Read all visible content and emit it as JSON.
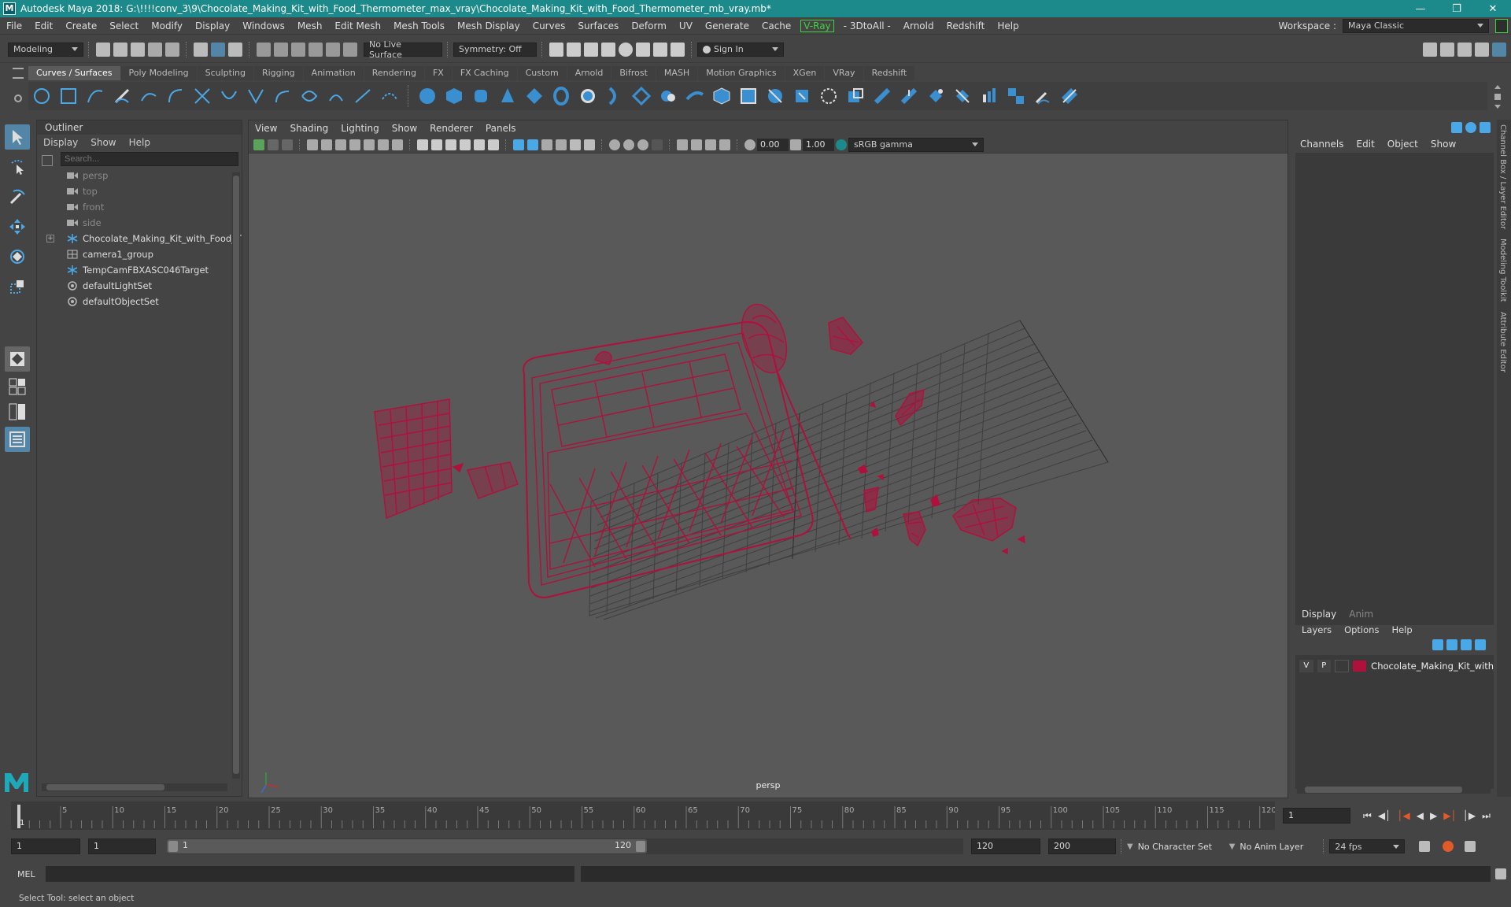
{
  "window": {
    "title": "Autodesk Maya 2018: G:\\!!!!conv_3\\9\\Chocolate_Making_Kit_with_Food_Thermometer_max_vray\\Chocolate_Making_Kit_with_Food_Thermometer_mb_vray.mb*",
    "logo": "M"
  },
  "menubar": {
    "items": [
      "File",
      "Edit",
      "Create",
      "Select",
      "Modify",
      "Display",
      "Windows",
      "Mesh",
      "Edit Mesh",
      "Mesh Tools",
      "Mesh Display",
      "Curves",
      "Surfaces",
      "Deform",
      "UV",
      "Generate",
      "Cache"
    ],
    "vray": "V-Ray",
    "items2": [
      "- 3DtoAll -",
      "Arnold",
      "Redshift",
      "Help"
    ],
    "workspace_label": "Workspace :",
    "workspace_value": "Maya Classic"
  },
  "statusline": {
    "mode": "Modeling",
    "live_surface": "No Live Surface",
    "symmetry": "Symmetry: Off",
    "sign_in": "Sign In"
  },
  "shelf": {
    "tabs": [
      "Curves / Surfaces",
      "Poly Modeling",
      "Sculpting",
      "Rigging",
      "Animation",
      "Rendering",
      "FX",
      "FX Caching",
      "Custom",
      "Arnold",
      "Bifrost",
      "MASH",
      "Motion Graphics",
      "XGen",
      "VRay",
      "Redshift"
    ],
    "active_tab": "Curves / Surfaces"
  },
  "outliner": {
    "title": "Outliner",
    "menu": [
      "Display",
      "Show",
      "Help"
    ],
    "search_placeholder": "Search...",
    "items": [
      {
        "label": "persp",
        "icon": "camera-icon",
        "dim": true
      },
      {
        "label": "top",
        "icon": "camera-icon",
        "dim": true
      },
      {
        "label": "front",
        "icon": "camera-icon",
        "dim": true
      },
      {
        "label": "side",
        "icon": "camera-icon",
        "dim": true
      },
      {
        "label": "Chocolate_Making_Kit_with_Food_Th",
        "icon": "transform-icon",
        "dim": false,
        "expandable": true
      },
      {
        "label": "camera1_group",
        "icon": "group-icon",
        "dim": false
      },
      {
        "label": "TempCamFBXASC046Target",
        "icon": "transform-icon",
        "dim": false
      },
      {
        "label": "defaultLightSet",
        "icon": "set-icon",
        "dim": false
      },
      {
        "label": "defaultObjectSet",
        "icon": "set-icon",
        "dim": false
      }
    ]
  },
  "viewport": {
    "menu": [
      "View",
      "Shading",
      "Lighting",
      "Show",
      "Renderer",
      "Panels"
    ],
    "exposure": "0.00",
    "gamma": "1.00",
    "color_space": "sRGB gamma",
    "camera_label": "persp",
    "wire_color": "#b0103c"
  },
  "channelbox": {
    "menu": [
      "Channels",
      "Edit",
      "Object",
      "Show"
    ],
    "layer_tabs": [
      "Display",
      "Anim"
    ],
    "layer_menu": [
      "Layers",
      "Options",
      "Help"
    ],
    "layer": {
      "v": "V",
      "p": "P",
      "name": "Chocolate_Making_Kit_with_Fo",
      "color": "#b0103c"
    },
    "side_tabs": [
      "Channel Box / Layer Editor",
      "Modeling Toolkit",
      "Attribute Editor"
    ]
  },
  "timeline": {
    "ticks": [
      "5",
      "10",
      "15",
      "20",
      "25",
      "30",
      "35",
      "40",
      "45",
      "50",
      "55",
      "60",
      "65",
      "70",
      "75",
      "80",
      "85",
      "90",
      "95",
      "100",
      "105",
      "110",
      "115",
      "120"
    ],
    "start_marker": "1",
    "current_frame": "1"
  },
  "range": {
    "start": "1",
    "playback_start": "1",
    "slider_start": "1",
    "slider_end": "120",
    "playback_end": "120",
    "end": "200",
    "character_set": "No Character Set",
    "anim_layer": "No Anim Layer",
    "fps": "24 fps"
  },
  "cmdline": {
    "label": "MEL"
  },
  "helpline": {
    "text": "Select Tool: select an object"
  }
}
